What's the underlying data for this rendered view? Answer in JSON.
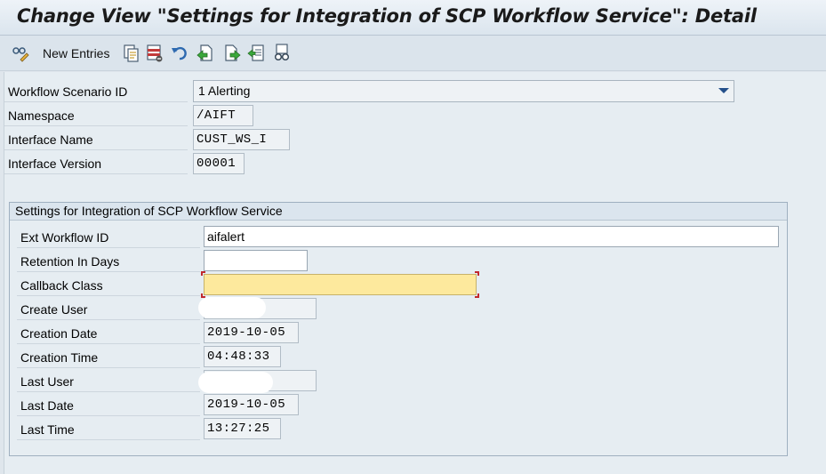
{
  "window": {
    "title": "Change View \"Settings for Integration of SCP Workflow Service\": Detail"
  },
  "toolbar": {
    "new_entries_label": "New Entries",
    "icons": [
      "display-change-icon",
      "copy-icon",
      "delete-icon",
      "undo-icon",
      "previous-entry-icon",
      "next-entry-icon",
      "select-block-icon",
      "glasses-icon"
    ]
  },
  "header_fields": {
    "scenario": {
      "label": "Workflow Scenario ID",
      "value": "1 Alerting"
    },
    "namespace": {
      "label": "Namespace",
      "value": "/AIFT"
    },
    "interface_name": {
      "label": "Interface Name",
      "value": "CUST_WS_I"
    },
    "interface_version": {
      "label": "Interface Version",
      "value": "00001"
    }
  },
  "group": {
    "title": "Settings for Integration of SCP Workflow Service",
    "ext_workflow_id": {
      "label": "Ext Workflow ID",
      "value": "aifalert"
    },
    "retention_days": {
      "label": "Retention In Days",
      "value": ""
    },
    "callback_class": {
      "label": "Callback Class",
      "value": ""
    },
    "create_user": {
      "label": "Create User",
      "value": ""
    },
    "creation_date": {
      "label": "Creation Date",
      "value": "2019-10-05"
    },
    "creation_time": {
      "label": "Creation Time",
      "value": "04:48:33"
    },
    "last_user": {
      "label": "Last User",
      "value": ""
    },
    "last_date": {
      "label": "Last Date",
      "value": "2019-10-05"
    },
    "last_time": {
      "label": "Last Time",
      "value": "13:27:25"
    }
  },
  "colors": {
    "required_field": "#fde99d",
    "required_marker": "#c0282d",
    "dropdown_arrow": "#234f8a"
  }
}
